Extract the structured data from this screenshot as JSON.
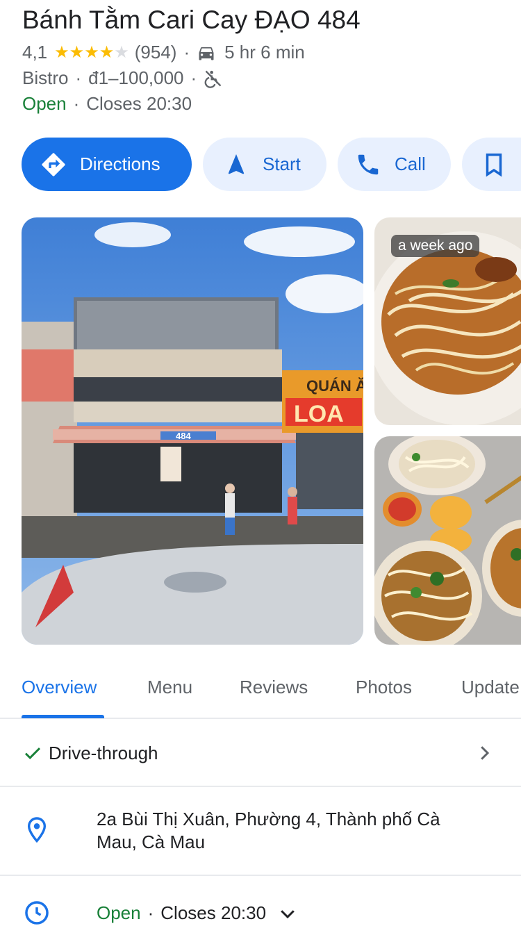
{
  "place": {
    "name": "Bánh Tằm Cari Cay ĐẠO 484",
    "rating": "4,1",
    "rating_value": 4.1,
    "review_count": "(954)",
    "drive_time": "5 hr 6 min",
    "category": "Bistro",
    "price": "đ1–100,000",
    "status": "Open",
    "closes": "Closes 20:30"
  },
  "actions": {
    "directions": "Directions",
    "start": "Start",
    "call": "Call"
  },
  "photos": {
    "badge": "a week ago",
    "main_sign_1": "QUÁN Ă",
    "main_sign_2": "LOA",
    "main_number": "484"
  },
  "tabs": [
    "Overview",
    "Menu",
    "Reviews",
    "Photos",
    "Update"
  ],
  "details": {
    "drive_through": "Drive-through",
    "address_line1": "2a Bùi Thị Xuân, Phường 4, Thành phố Cà",
    "address_line2": "Mau, Cà Mau",
    "hours_status": "Open",
    "hours_closes": "Closes 20:30"
  },
  "colors": {
    "accent": "#1a73e8",
    "accent_soft": "#e8f0fe",
    "open_green": "#188038",
    "star": "#fbbc04"
  }
}
